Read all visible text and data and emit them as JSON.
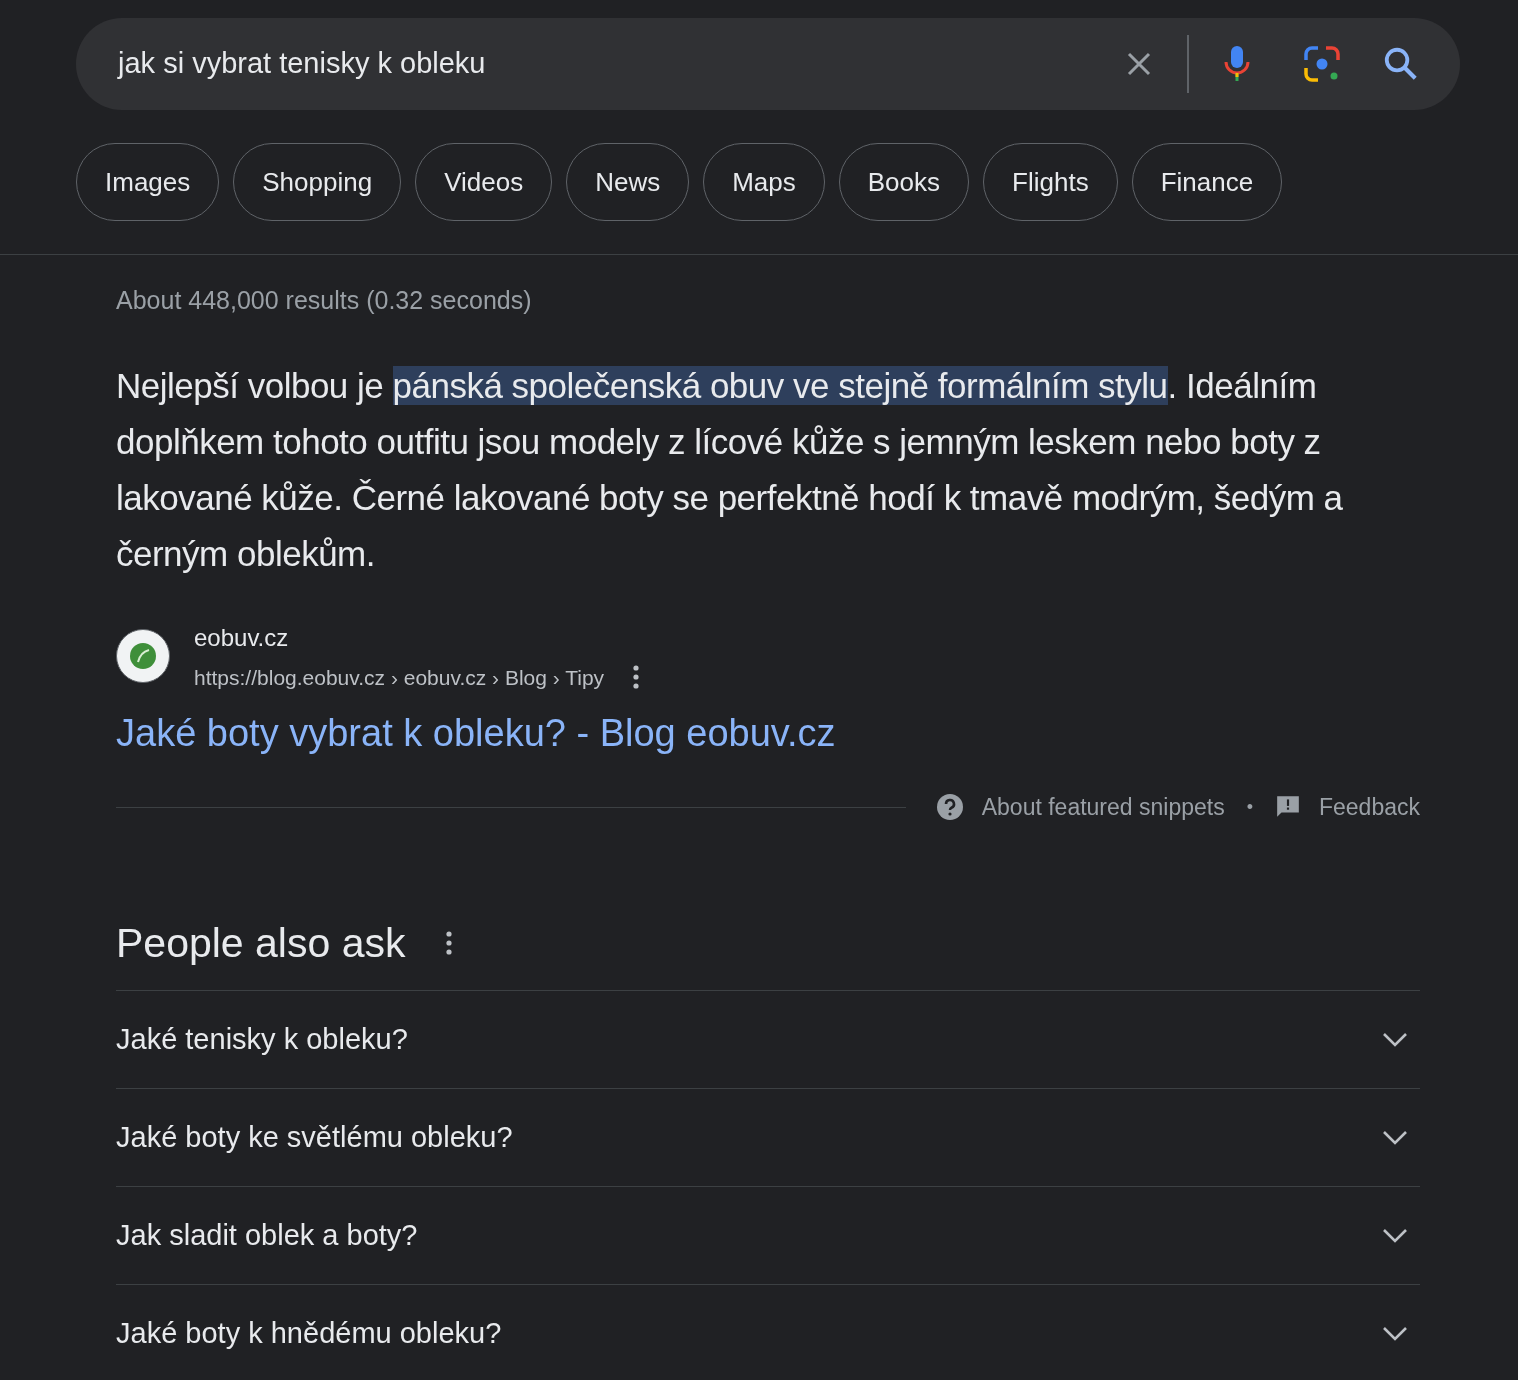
{
  "search": {
    "value": "jak si vybrat tenisky k obleku"
  },
  "chips": [
    "Images",
    "Shopping",
    "Videos",
    "News",
    "Maps",
    "Books",
    "Flights",
    "Finance"
  ],
  "result_stats": "About 448,000 results (0.32 seconds)",
  "snippet": {
    "before": "Nejlepší volbou je ",
    "highlighted": "pánská společenská obuv ve stejně formálním stylu",
    "after": ". Ideálním doplňkem tohoto outfitu jsou modely z lícové kůže s jemným leskem nebo boty z lakované kůže. Černé lakované boty se perfektně hodí k tmavě modrým, šedým a černým oblekům."
  },
  "source": {
    "site": "eobuv.cz",
    "url": "https://blog.eobuv.cz › eobuv.cz › Blog › Tipy",
    "title": "Jaké boty vybrat k obleku? - Blog eobuv.cz"
  },
  "snippet_footer": {
    "about": "About featured snippets",
    "separator": "•",
    "feedback": "Feedback"
  },
  "people_also_ask": {
    "heading": "People also ask",
    "questions": [
      {
        "text": "Jaké tenisky k obleku?",
        "expanded": false
      },
      {
        "text": "Jaké boty ke světlému obleku?",
        "expanded": false
      },
      {
        "text": "Jak sladit oblek a boty?",
        "expanded": false
      },
      {
        "text": "Jaké boty k hnědému obleku?",
        "expanded": false
      }
    ]
  }
}
